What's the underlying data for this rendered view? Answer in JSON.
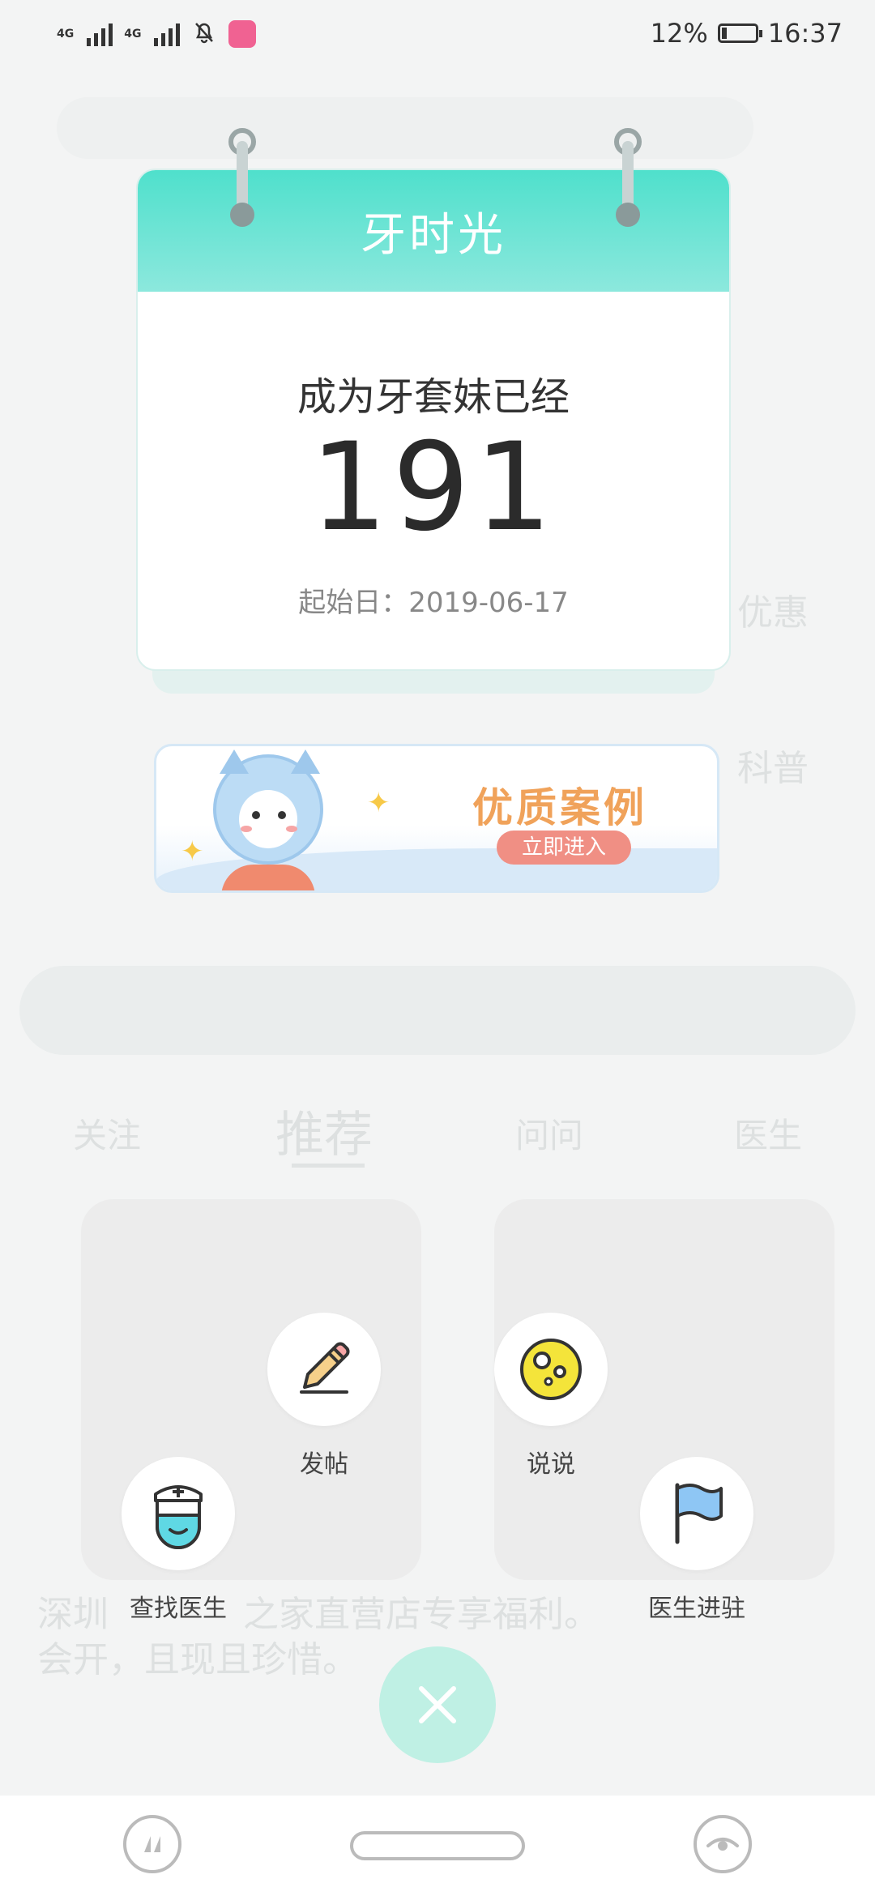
{
  "status_bar": {
    "network_1": "4G",
    "network_2": "4G",
    "battery": "12%",
    "time": "16:37"
  },
  "background": {
    "tabs": [
      "关注",
      "推荐",
      "问问",
      "医生"
    ],
    "side_labels": [
      "优惠",
      "科普"
    ],
    "text_line_1": "深圳",
    "text_line_2": "之家直营店专享福利。",
    "text_line_3": "会开，且现且珍惜。"
  },
  "calendar": {
    "title": "牙时光",
    "label": "成为牙套妹已经",
    "days": "191",
    "start_label": "起始日：",
    "start_date": "2019-06-17"
  },
  "case_banner": {
    "title": "优质案例",
    "button": "立即进入"
  },
  "actions": {
    "post": "发帖",
    "talk": "说说",
    "find_doctor": "查找医生",
    "doctor_join": "医生进驻"
  },
  "icons": {
    "post": "pencil-icon",
    "talk": "moon-icon",
    "find_doctor": "nurse-icon",
    "doctor_join": "flag-icon",
    "close": "close-icon"
  },
  "colors": {
    "accent": "#4fe0cc",
    "fab": "#bff0e4",
    "case_title": "#f0a25a",
    "case_button": "#f08f84"
  }
}
